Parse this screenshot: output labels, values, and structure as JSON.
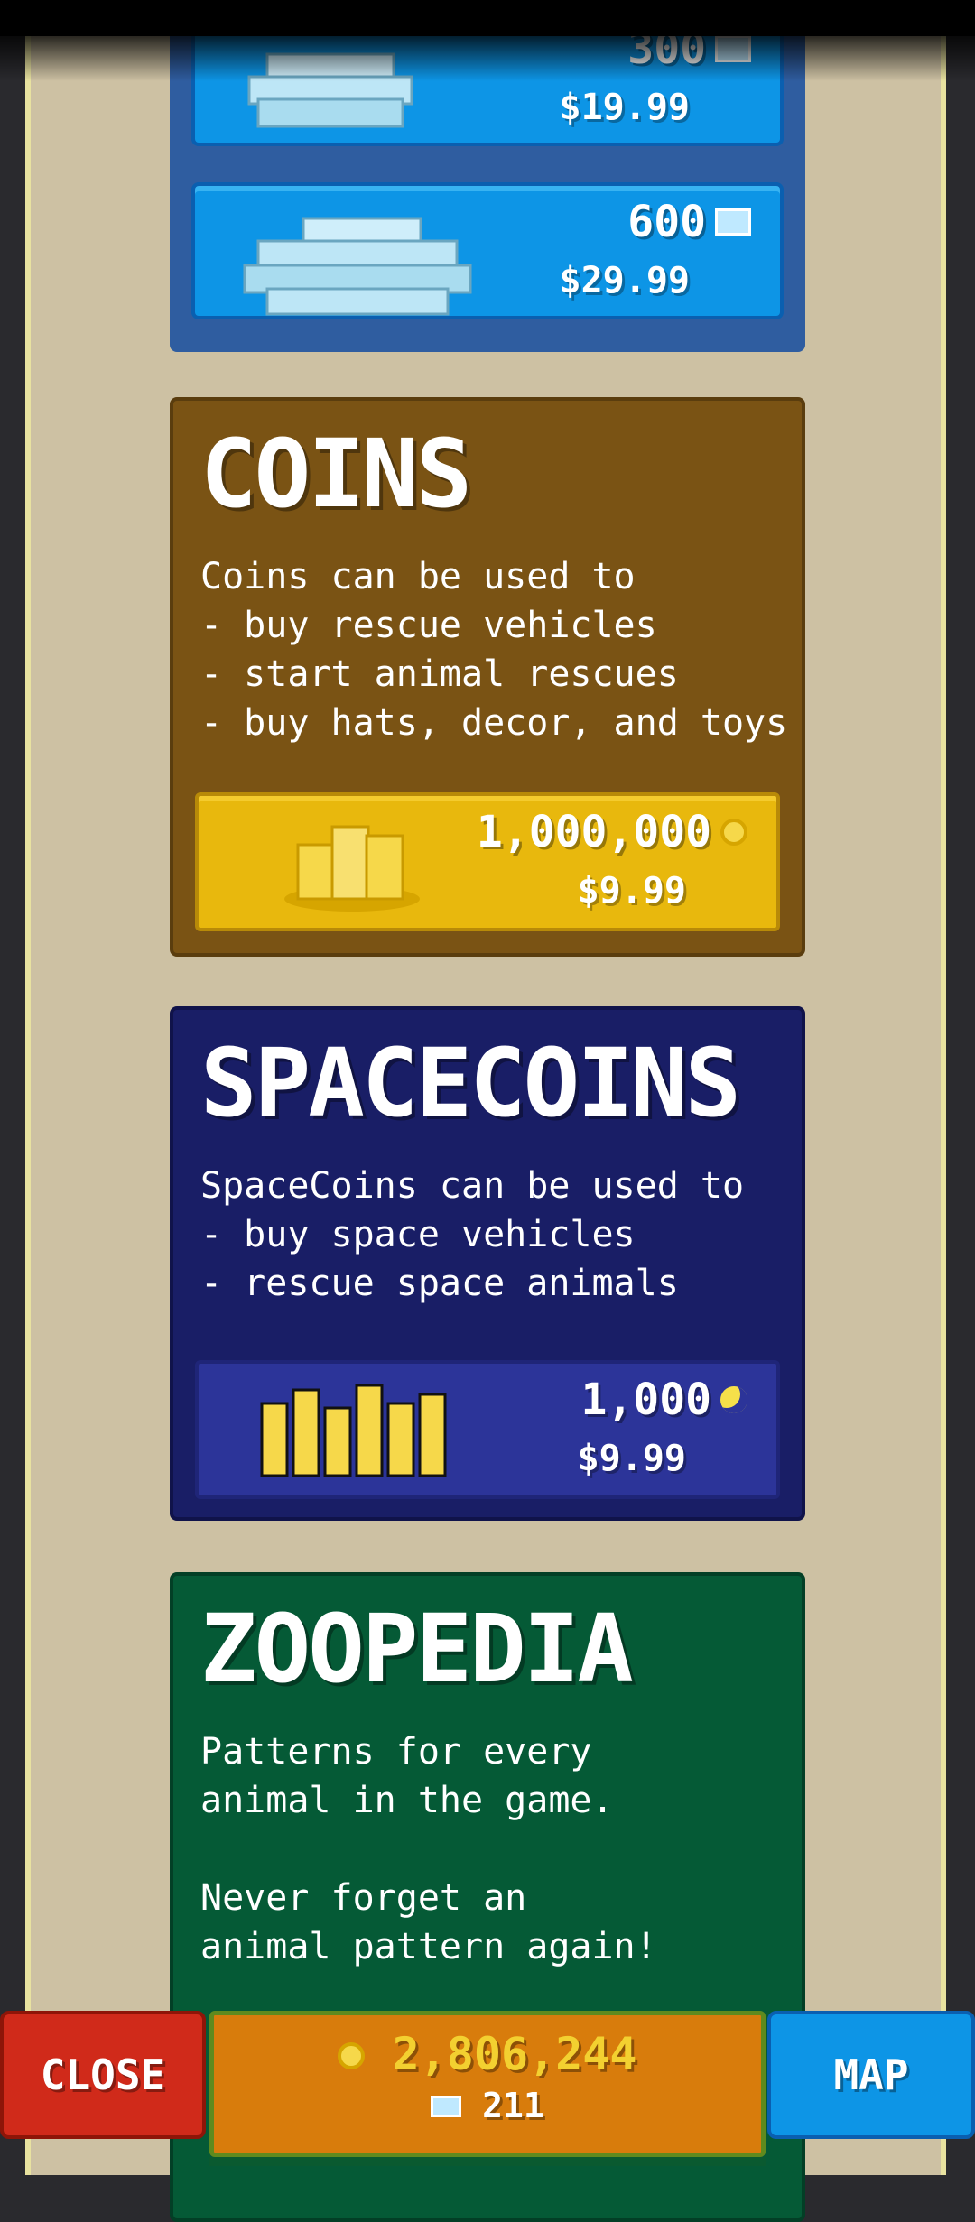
{
  "gems": {
    "items": [
      {
        "amount": "300",
        "price": "$19.99"
      },
      {
        "amount": "600",
        "price": "$29.99"
      }
    ]
  },
  "coins": {
    "title": "COINS",
    "description": "Coins can be used to\n- buy rescue vehicles\n- start animal rescues\n- buy hats, decor, and toys",
    "amount": "1,000,000",
    "price": "$9.99"
  },
  "spacecoins": {
    "title": "SPACECOINS",
    "description": "SpaceCoins can be used to\n- buy space vehicles\n- rescue space animals",
    "amount": "1,000",
    "price": "$9.99"
  },
  "zoopedia": {
    "title": "ZOOPEDIA",
    "description": "Patterns for every\nanimal in the game.\n\nNever forget an\nanimal pattern again!"
  },
  "bottom_bar": {
    "close_label": "CLOSE",
    "map_label": "MAP",
    "coin_balance": "2,806,244",
    "gem_balance": "211"
  },
  "icons": {
    "gem": "gem-icon",
    "coin": "coin-icon",
    "spacecoin": "spacecoin-icon"
  },
  "colors": {
    "gem_button": "#0d95e6",
    "coins_card": "#7a5314",
    "coin_button": "#e8b80d",
    "space_card": "#191e66",
    "zoo_card": "#055a36",
    "close": "#d02a1a",
    "center_bar": "#d87c0c"
  }
}
